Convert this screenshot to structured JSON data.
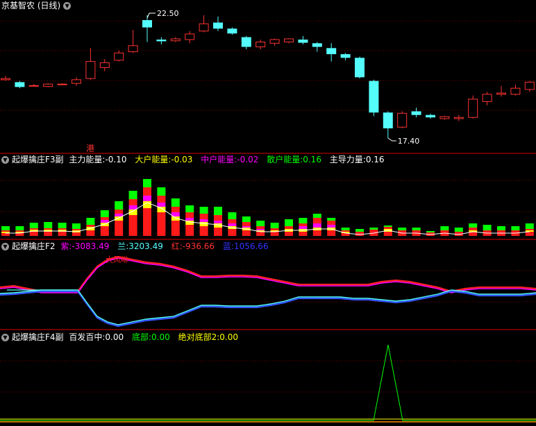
{
  "panel1": {
    "title": "京基智农 (日线)",
    "max_label": "22.50",
    "min_label": "17.40",
    "marker": "港",
    "menu_icon": "chevron-down-icon"
  },
  "panel2": {
    "name": "起爆擒庄F3副",
    "items": [
      {
        "label": "主力能量:",
        "value": "-0.10",
        "color": "#ffffff"
      },
      {
        "label": "大户能量:",
        "value": "-0.03",
        "color": "#ffff00"
      },
      {
        "label": "中户能量:",
        "value": "-0.02",
        "color": "#ff00ff"
      },
      {
        "label": "散户能量:",
        "value": "0.16",
        "color": "#00ff00"
      },
      {
        "label": "主导力量:",
        "value": "0.16",
        "color": "#ffffff"
      }
    ]
  },
  "panel3": {
    "name": "起爆擒庄F2",
    "items": [
      {
        "label": "紫:",
        "value": "-3083.49",
        "color": "#ff00ff"
      },
      {
        "label": "兰:",
        "value": "3203.49",
        "color": "#55ffff"
      },
      {
        "label": "红:",
        "value": "-936.66",
        "color": "#ff3333"
      },
      {
        "label": "蓝:",
        "value": "1056.66",
        "color": "#3333ff"
      }
    ],
    "annotation": "大风咻"
  },
  "panel4": {
    "name": "起爆擒庄F4副",
    "items": [
      {
        "label": "百发百中:",
        "value": "0.00",
        "color": "#ffffff"
      },
      {
        "label": "底部:",
        "value": "0.00",
        "color": "#00ff00"
      },
      {
        "label": "绝对底部2:",
        "value": "0.00",
        "color": "#ffff00"
      }
    ]
  },
  "colors": {
    "up": "#ff3333",
    "down": "#54fcfc",
    "bg": "#000000",
    "grid": "#8b0000"
  },
  "chart_data": {
    "type": "candlestick",
    "candles": [
      {
        "o": 19.9,
        "h": 20.05,
        "l": 19.85,
        "c": 19.95
      },
      {
        "o": 19.8,
        "h": 19.85,
        "l": 19.55,
        "c": 19.6
      },
      {
        "o": 19.65,
        "h": 19.72,
        "l": 19.62,
        "c": 19.66
      },
      {
        "o": 19.62,
        "h": 19.75,
        "l": 19.6,
        "c": 19.72
      },
      {
        "o": 19.7,
        "h": 19.75,
        "l": 19.68,
        "c": 19.72
      },
      {
        "o": 19.75,
        "h": 20.0,
        "l": 19.65,
        "c": 19.9
      },
      {
        "o": 19.95,
        "h": 21.2,
        "l": 19.9,
        "c": 20.65
      },
      {
        "o": 20.4,
        "h": 20.75,
        "l": 20.25,
        "c": 20.6
      },
      {
        "o": 20.7,
        "h": 21.1,
        "l": 20.65,
        "c": 21.0
      },
      {
        "o": 21.05,
        "h": 21.95,
        "l": 21.0,
        "c": 21.3
      },
      {
        "o": 22.35,
        "h": 22.55,
        "l": 21.45,
        "c": 22.05
      },
      {
        "o": 21.55,
        "h": 21.65,
        "l": 21.35,
        "c": 21.48
      },
      {
        "o": 21.5,
        "h": 21.65,
        "l": 21.45,
        "c": 21.58
      },
      {
        "o": 21.55,
        "h": 21.9,
        "l": 21.4,
        "c": 21.78
      },
      {
        "o": 21.9,
        "h": 22.55,
        "l": 21.85,
        "c": 22.2
      },
      {
        "o": 22.25,
        "h": 22.5,
        "l": 21.9,
        "c": 22.0
      },
      {
        "o": 22.0,
        "h": 22.05,
        "l": 21.75,
        "c": 21.8
      },
      {
        "o": 21.65,
        "h": 21.7,
        "l": 21.15,
        "c": 21.25
      },
      {
        "o": 21.25,
        "h": 21.55,
        "l": 21.15,
        "c": 21.45
      },
      {
        "o": 21.4,
        "h": 21.6,
        "l": 21.3,
        "c": 21.55
      },
      {
        "o": 21.45,
        "h": 21.6,
        "l": 21.4,
        "c": 21.58
      },
      {
        "o": 21.55,
        "h": 21.7,
        "l": 21.35,
        "c": 21.42
      },
      {
        "o": 21.4,
        "h": 21.45,
        "l": 21.05,
        "c": 21.25
      },
      {
        "o": 21.2,
        "h": 21.4,
        "l": 20.65,
        "c": 20.95
      },
      {
        "o": 20.95,
        "h": 21.0,
        "l": 20.7,
        "c": 20.8
      },
      {
        "o": 20.8,
        "h": 20.85,
        "l": 19.95,
        "c": 20.0
      },
      {
        "o": 19.85,
        "h": 19.9,
        "l": 18.4,
        "c": 18.55
      },
      {
        "o": 18.55,
        "h": 18.6,
        "l": 17.5,
        "c": 17.9
      },
      {
        "o": 17.95,
        "h": 18.6,
        "l": 17.9,
        "c": 18.52
      },
      {
        "o": 18.6,
        "h": 18.75,
        "l": 18.35,
        "c": 18.45
      },
      {
        "o": 18.45,
        "h": 18.5,
        "l": 18.3,
        "c": 18.35
      },
      {
        "o": 18.3,
        "h": 18.42,
        "l": 18.25,
        "c": 18.38
      },
      {
        "o": 18.3,
        "h": 18.45,
        "l": 18.2,
        "c": 18.35
      },
      {
        "o": 18.35,
        "h": 19.25,
        "l": 18.3,
        "c": 19.1
      },
      {
        "o": 19.0,
        "h": 19.4,
        "l": 18.85,
        "c": 19.3
      },
      {
        "o": 19.3,
        "h": 19.65,
        "l": 19.2,
        "c": 19.35
      },
      {
        "o": 19.3,
        "h": 19.7,
        "l": 19.25,
        "c": 19.55
      },
      {
        "o": 19.5,
        "h": 19.85,
        "l": 19.4,
        "c": 19.8
      }
    ]
  }
}
